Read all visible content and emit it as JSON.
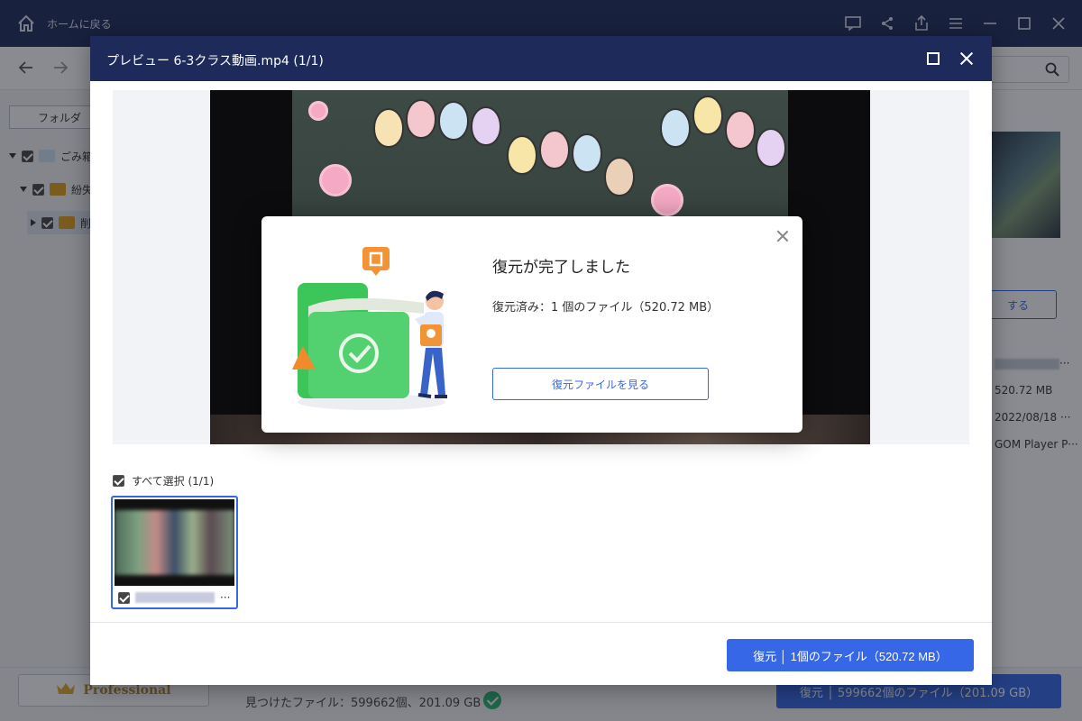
{
  "app": {
    "home_label": "ホームに戻る",
    "folder_tab": "フォルダ",
    "tree": [
      {
        "label": "ごみ箱"
      },
      {
        "label": "紛失"
      },
      {
        "label": "削"
      }
    ],
    "right_panel": {
      "button_label": "する",
      "size": "520.72 MB",
      "date": "2022/08/18 ···",
      "app": "GOM Player P···",
      "name_more": "···"
    },
    "footer": {
      "pro_label": "Professional",
      "found_text": "見つけたファイル：599662個、201.09 GB",
      "recover_label": "復元 │ 599662個のファイル（201.09 GB）"
    }
  },
  "preview": {
    "title": "プレビュー 6-3クラス動画.mp4 (1/1)",
    "select_all_label": "すべて選択 (1/1)",
    "thumb_more": "···",
    "recover_label": "復元 │ 1個のファイル（520.72 MB）"
  },
  "dialog": {
    "title": "復元が完了しました",
    "detail": "復元済み：1 個のファイル（520.72 MB）",
    "view_button": "復元ファイルを見る"
  },
  "colors": {
    "title_bar": "#1d2a5a",
    "accent": "#3567e6",
    "success": "#2bb673",
    "folder_green": "#3cc65a"
  }
}
